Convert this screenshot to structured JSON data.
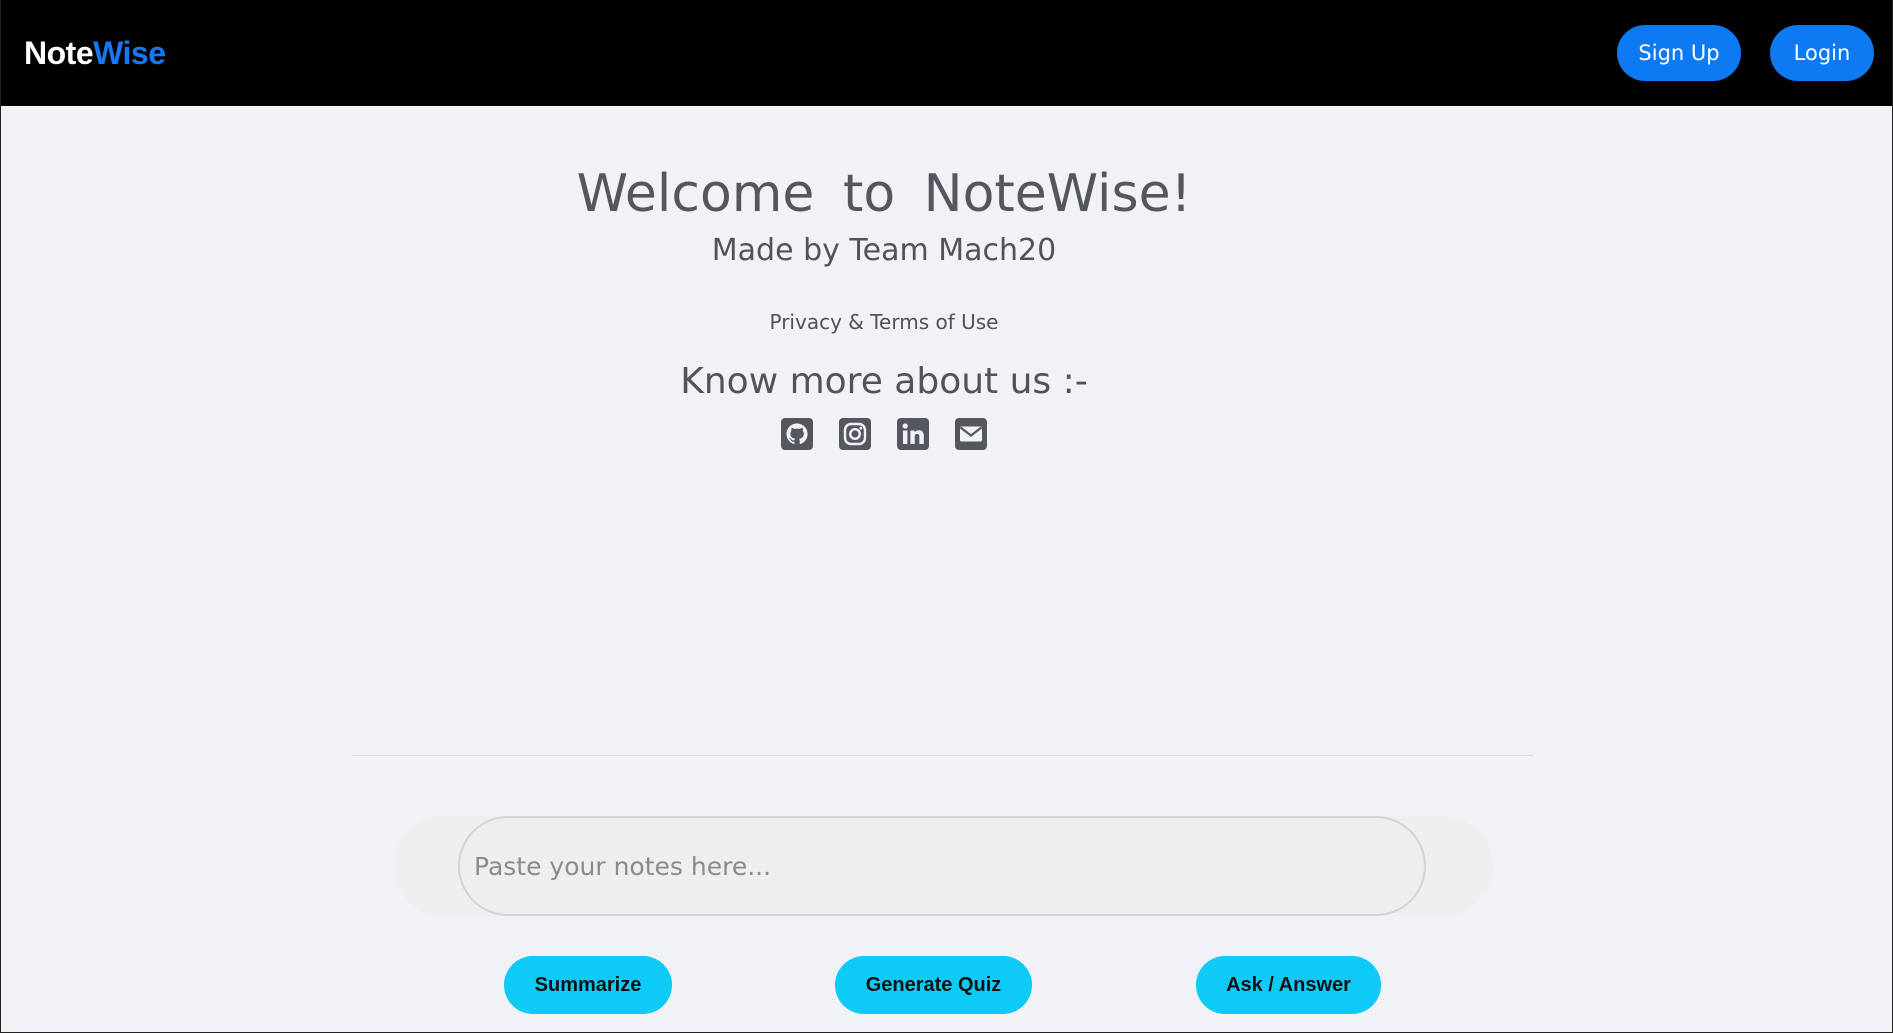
{
  "header": {
    "logo_part1": "Note",
    "logo_part2": "Wise",
    "signup_label": "Sign Up",
    "login_label": "Login"
  },
  "hero": {
    "title": "Welcome to NoteWise!",
    "subtitle": "Made by Team Mach20",
    "privacy_link": "Privacy & Terms of Use",
    "more_heading": "Know more about us :-"
  },
  "social_icons": [
    "github-icon",
    "instagram-icon",
    "linkedin-icon",
    "mail-icon"
  ],
  "notes": {
    "placeholder": "Paste your notes here...",
    "value": ""
  },
  "actions": {
    "summarize_label": "Summarize",
    "quiz_label": "Generate Quiz",
    "ask_label": "Ask / Answer"
  },
  "colors": {
    "header_bg": "#000000",
    "logo_accent": "#1877f2",
    "auth_button": "#0d79f2",
    "action_button": "#0dcaf7",
    "page_bg": "#f0f2f6"
  }
}
